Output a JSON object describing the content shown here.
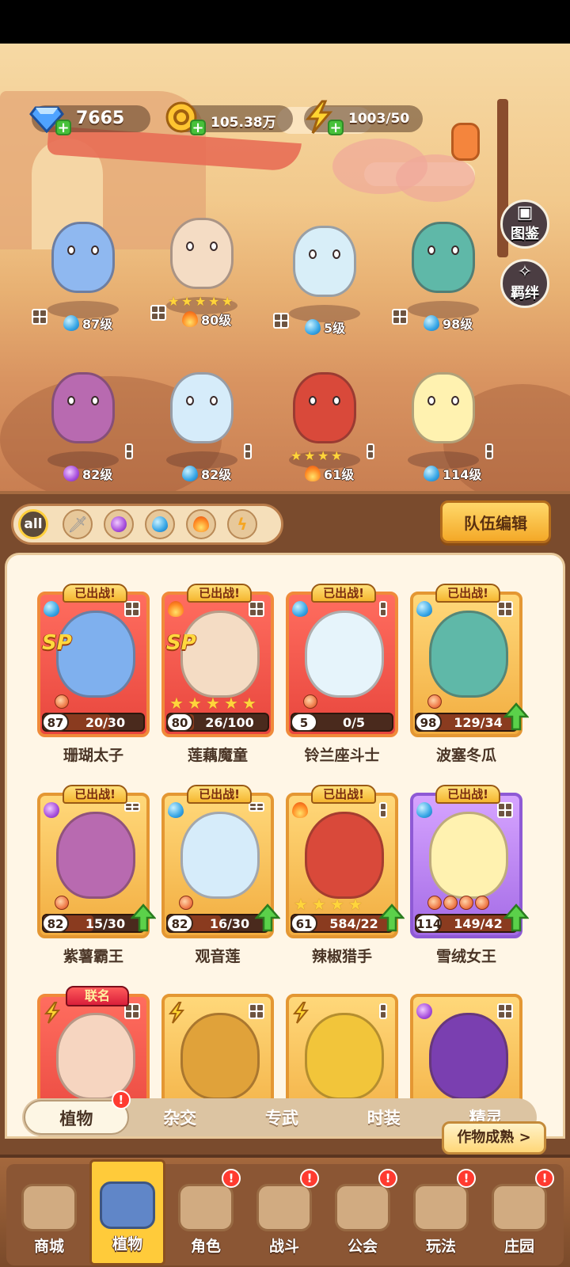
{
  "resources": {
    "gems": "7665",
    "coins": "105.38万",
    "energy": "1003/50"
  },
  "side_buttons": [
    {
      "label": "图鉴",
      "icon": "book-icon"
    },
    {
      "label": "羁绊",
      "icon": "bond-icon"
    }
  ],
  "battle_heroes": [
    {
      "level": "87级",
      "element": "water",
      "stars": 0,
      "color": "#8fb8f0"
    },
    {
      "level": "80级",
      "element": "fire",
      "stars": 5,
      "color": "#f4dcc4"
    },
    {
      "level": "5级",
      "element": "water",
      "stars": 0,
      "color": "#d8eef8"
    },
    {
      "level": "98级",
      "element": "water",
      "stars": 0,
      "color": "#5fb8a8"
    },
    {
      "level": "82级",
      "element": "poison",
      "stars": 0,
      "color": "#b86ab0"
    },
    {
      "level": "82级",
      "element": "water",
      "stars": 0,
      "color": "#d6ecfa"
    },
    {
      "level": "61级",
      "element": "fire",
      "stars": 4,
      "color": "#d9493a"
    },
    {
      "level": "114级",
      "element": "water",
      "stars": 0,
      "color": "#fff2b0"
    }
  ],
  "filter": {
    "all_label": "all",
    "team_edit": "队伍编辑"
  },
  "cards": [
    {
      "name": "珊瑚太子",
      "badge": "已出战!",
      "level": "87",
      "progress": "20/30",
      "fill": 0.67,
      "theme": "red",
      "element": "water",
      "sp": "SP",
      "stars": 0,
      "up": false,
      "color": "#7fb0ee"
    },
    {
      "name": "莲藕魔童",
      "badge": "已出战!",
      "level": "80",
      "progress": "26/100",
      "fill": 0.26,
      "theme": "red",
      "element": "fire",
      "sp": "SP",
      "stars": 5,
      "up": false,
      "color": "#f4dcc4"
    },
    {
      "name": "铃兰座斗士",
      "badge": "已出战!",
      "level": "5",
      "progress": "0/5",
      "fill": 0,
      "theme": "red",
      "element": "water",
      "sp": "",
      "stars": 0,
      "up": false,
      "color": "#e6f4fb"
    },
    {
      "name": "波塞冬瓜",
      "badge": "已出战!",
      "level": "98",
      "progress": "129/34",
      "fill": 1,
      "theme": "gold",
      "element": "water",
      "sp": "",
      "stars": 0,
      "up": true,
      "color": "#5fb8a8"
    },
    {
      "name": "紫薯霸王",
      "badge": "已出战!",
      "level": "82",
      "progress": "15/30",
      "fill": 0.5,
      "theme": "gold",
      "element": "poison",
      "sp": "",
      "stars": 0,
      "up": true,
      "color": "#b86ab0"
    },
    {
      "name": "观音莲",
      "badge": "已出战!",
      "level": "82",
      "progress": "16/30",
      "fill": 0.53,
      "theme": "gold",
      "element": "water",
      "sp": "",
      "stars": 0,
      "up": true,
      "color": "#d6ecfa"
    },
    {
      "name": "辣椒猎手",
      "badge": "已出战!",
      "level": "61",
      "progress": "584/22",
      "fill": 1,
      "theme": "gold",
      "element": "fire",
      "sp": "",
      "stars": 4,
      "up": true,
      "color": "#d9493a"
    },
    {
      "name": "雪绒女王",
      "badge": "已出战!",
      "level": "114",
      "progress": "149/42",
      "fill": 1,
      "theme": "purple",
      "element": "water",
      "sp": "",
      "stars": 0,
      "up": true,
      "color": "#fff2b0"
    }
  ],
  "partial_cards": [
    {
      "badge": "联名",
      "theme": "red",
      "color": "#f6d5c0"
    },
    {
      "badge": "",
      "theme": "gold",
      "color": "#e0a23a"
    },
    {
      "badge": "",
      "theme": "gold",
      "color": "#f2c53a"
    },
    {
      "badge": "",
      "theme": "gold",
      "color": "#7a3fb0"
    }
  ],
  "tabs": [
    "植物",
    "杂交",
    "专武",
    "时装",
    "精灵"
  ],
  "ripe_button": "作物成熟 >",
  "nav": [
    "商城",
    "植物",
    "角色",
    "战斗",
    "公会",
    "玩法",
    "庄园"
  ],
  "nav_active": "植物",
  "alert_mark": "!"
}
